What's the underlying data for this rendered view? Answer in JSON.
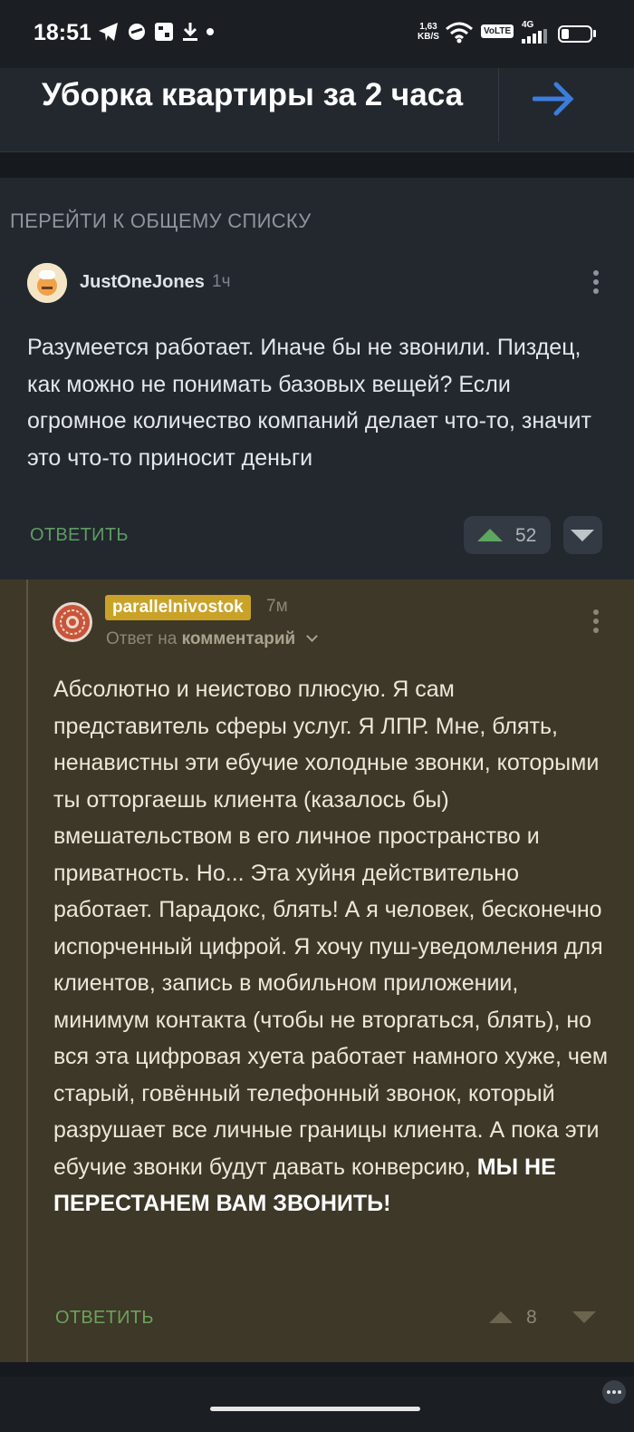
{
  "status_bar": {
    "time": "18:51",
    "net_speed_value": "1,63",
    "net_speed_unit": "KB/S",
    "volte": "VoLTE",
    "network": "4G",
    "icons": [
      "telegram-icon",
      "app-icon",
      "gallery-icon",
      "download-icon",
      "dot-icon",
      "wifi-icon",
      "signal-icon",
      "battery-icon"
    ]
  },
  "banner": {
    "title": "Уборка квартиры за 2 часа",
    "arrow_icon": "arrow-right-icon",
    "arrow_color": "#3b7ddd"
  },
  "nav": {
    "goto_list": "ПЕРЕЙТИ К ОБЩЕМУ СПИСКУ"
  },
  "comment1": {
    "username": "JustOneJones",
    "time": "1ч",
    "text": "Разумеется работает. Иначе бы не звонили. Пиздец, как можно не понимать базовых вещей? Если огромное количество компаний делает что-то, значит это что-то приносит деньги",
    "reply_label": "ОТВЕТИТЬ",
    "rating": "52"
  },
  "comment2": {
    "username": "parallelnivostok",
    "time": "7м",
    "reply_to_prefix": "Ответ на",
    "reply_to_target": "комментарий",
    "text": "Абсолютно и неистово плюсую. Я сам представитель сферы услуг. Я ЛПР. Мне, блять, ненавистны эти ебучие холодные звонки, которыми ты отторгаешь клиента (казалось бы) вмешательством в его личное пространство и приватность. Но... Эта хуйня действительно работает. Парадокс, блять! А я человек, бесконечно испорченный цифрой. Я хочу пуш-уведомления для клиентов, запись в мобильном приложении, минимум контакта (чтобы не вторгаться, блять), но вся эта цифровая хуета работает намного хуже, чем старый, говённый телефонный звонок, который разрушает все личные границы клиента. А пока эти ебучие звонки будут давать конверсию,",
    "text_emphasis": "МЫ НЕ ПЕРЕСТАНЕМ ВАМ ЗВОНИТЬ!",
    "reply_label": "ОТВЕТИТЬ",
    "rating": "8"
  },
  "colors": {
    "background": "#23282f",
    "highlight_background": "#3d3828",
    "upvote": "#5ea65f",
    "reply_link": "#5e9c63",
    "username_badge": "#c9a227"
  }
}
